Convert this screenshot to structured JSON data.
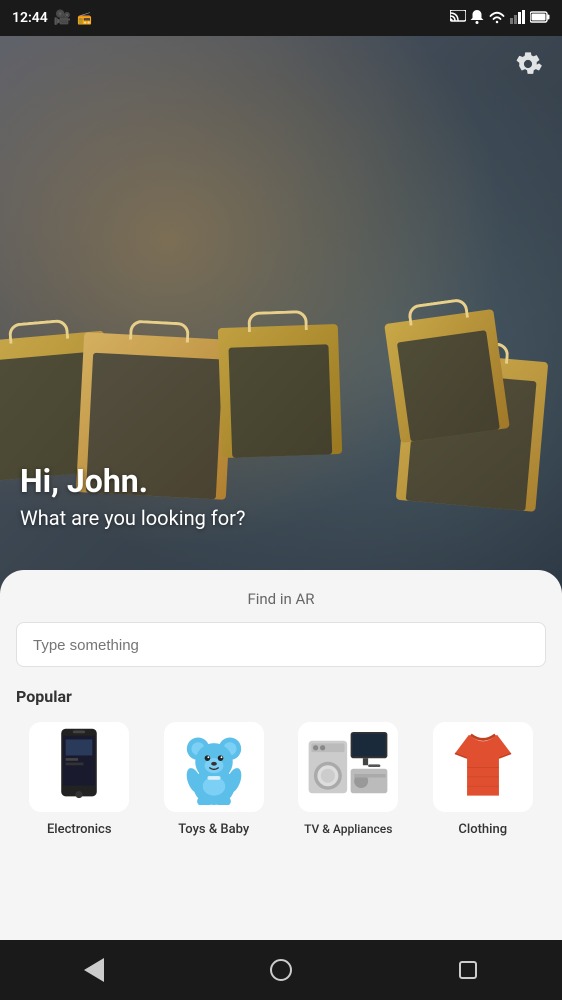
{
  "statusBar": {
    "time": "12:44",
    "icons": [
      "video-icon",
      "radio-icon",
      "cast-icon",
      "bell-icon",
      "wifi-icon",
      "signal-icon",
      "battery-icon"
    ]
  },
  "settings": {
    "icon": "gear-icon"
  },
  "hero": {
    "greeting": "Hi, John.",
    "subtitle": "What are you looking for?"
  },
  "card": {
    "findAR": "Find in AR",
    "searchPlaceholder": "Type something",
    "popularLabel": "Popular",
    "categories": [
      {
        "id": "electronics",
        "label": "Electronics"
      },
      {
        "id": "toys-baby",
        "label": "Toys & Baby"
      },
      {
        "id": "tv-appliances",
        "label": "TV & Appliances"
      },
      {
        "id": "clothing",
        "label": "Clothing"
      }
    ]
  },
  "bottomNav": {
    "items": [
      "back",
      "home",
      "recents"
    ]
  }
}
